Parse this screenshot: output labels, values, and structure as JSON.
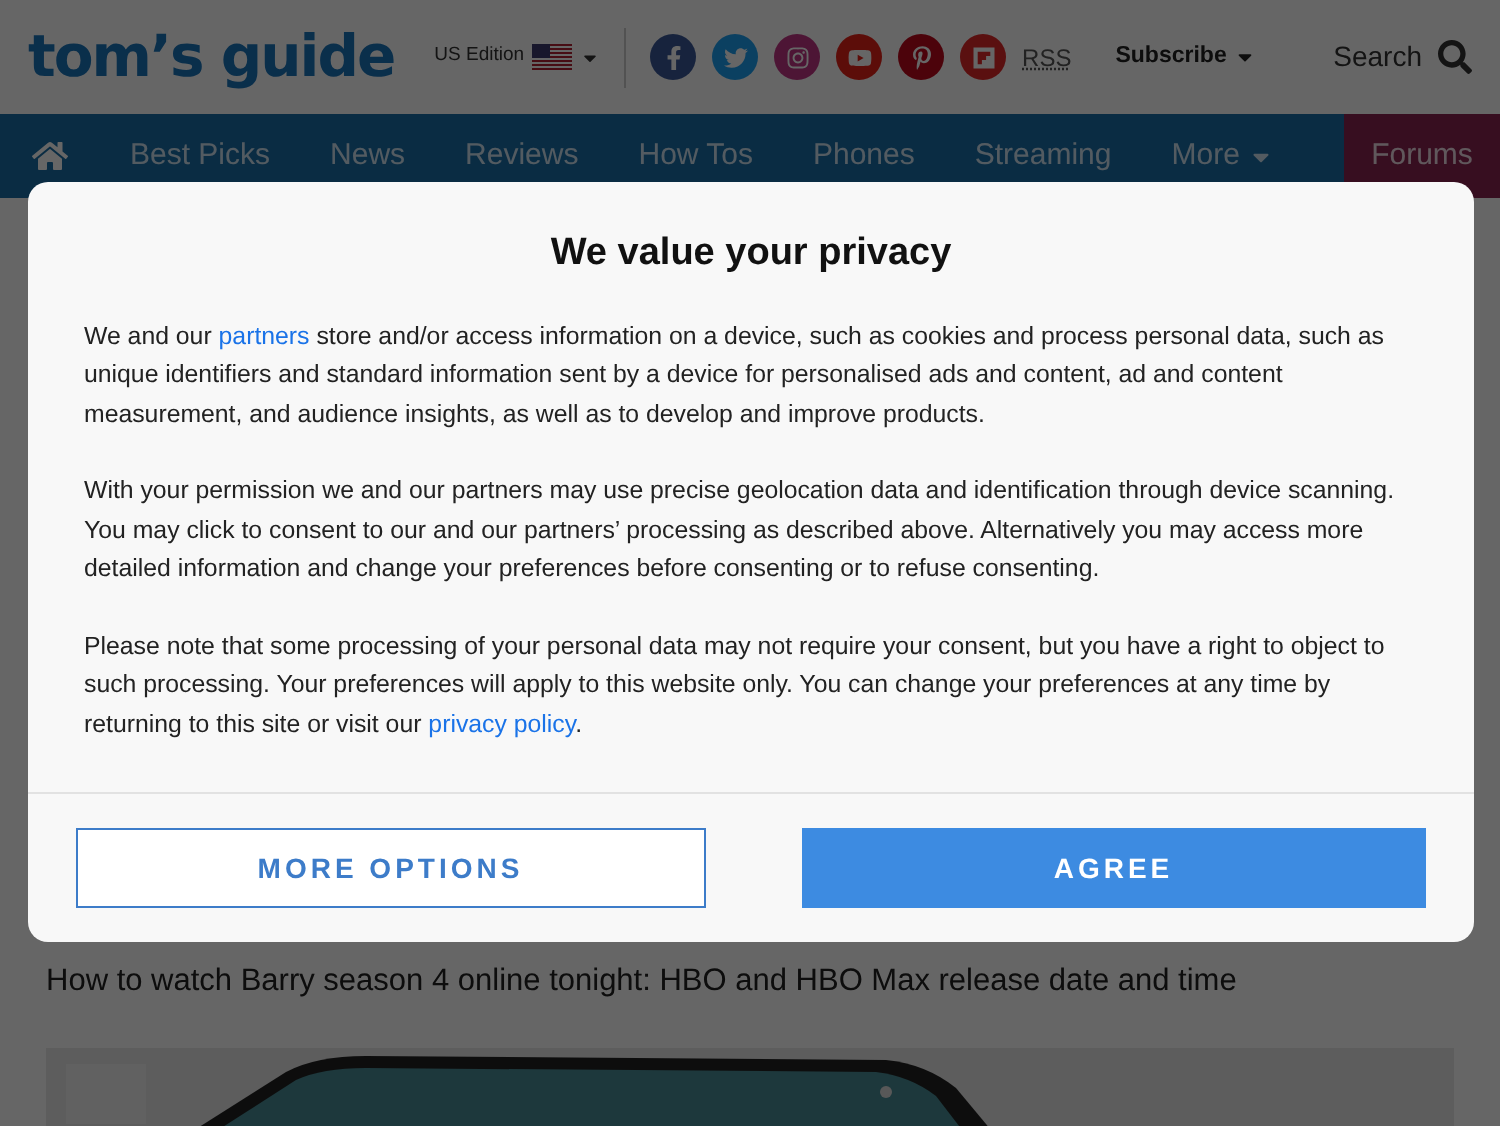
{
  "header": {
    "logo": "tom’s guide",
    "edition": "US Edition",
    "social": [
      {
        "kind": "facebook"
      },
      {
        "kind": "twitter"
      },
      {
        "kind": "instagram"
      },
      {
        "kind": "youtube"
      },
      {
        "kind": "pinterest"
      },
      {
        "kind": "flipboard"
      }
    ],
    "rss": "RSS",
    "subscribe": "Subscribe",
    "search": "Search"
  },
  "nav": [
    {
      "kind": "home"
    },
    {
      "kind": "link",
      "label": "Best Picks"
    },
    {
      "kind": "link",
      "label": "News"
    },
    {
      "kind": "link",
      "label": "Reviews"
    },
    {
      "kind": "link",
      "label": "How Tos"
    },
    {
      "kind": "link",
      "label": "Phones"
    },
    {
      "kind": "link",
      "label": "Streaming"
    },
    {
      "kind": "menu",
      "label": "More"
    },
    {
      "kind": "forums",
      "label": "Forums"
    }
  ],
  "content": {
    "headline": "How to watch Barry season 4 online tonight: HBO and HBO Max release date and time"
  },
  "dialog": {
    "title": "We value your privacy",
    "paragraphs": [
      [
        {
          "kind": "text",
          "text": "We and our "
        },
        {
          "kind": "link",
          "text": "partners"
        },
        {
          "kind": "text",
          "text": " store and/or access information on a device, such as cookies and process personal data, such as unique identifiers and standard information sent by a device for personalised ads and content, ad and content measurement, and audience insights, as well as to develop and improve products."
        }
      ],
      [
        {
          "kind": "text",
          "text": "With your permission we and our partners may use precise geolocation data and identification through device scanning. You may click to consent to our and our partners’ processing as described above. Alternatively you may access more detailed information and change your preferences before consenting or to refuse consenting."
        }
      ],
      [
        {
          "kind": "text",
          "text": "Please note that some processing of your personal data may not require your consent, but you have a right to object to such processing. Your preferences will apply to this website only. You can change your preferences at any time by returning to this site or visit our "
        },
        {
          "kind": "link",
          "text": "privacy policy"
        },
        {
          "kind": "text",
          "text": "."
        }
      ]
    ],
    "buttons": [
      {
        "kind": "secondary",
        "label": "MORE OPTIONS"
      },
      {
        "kind": "primary",
        "label": "AGREE"
      }
    ]
  }
}
